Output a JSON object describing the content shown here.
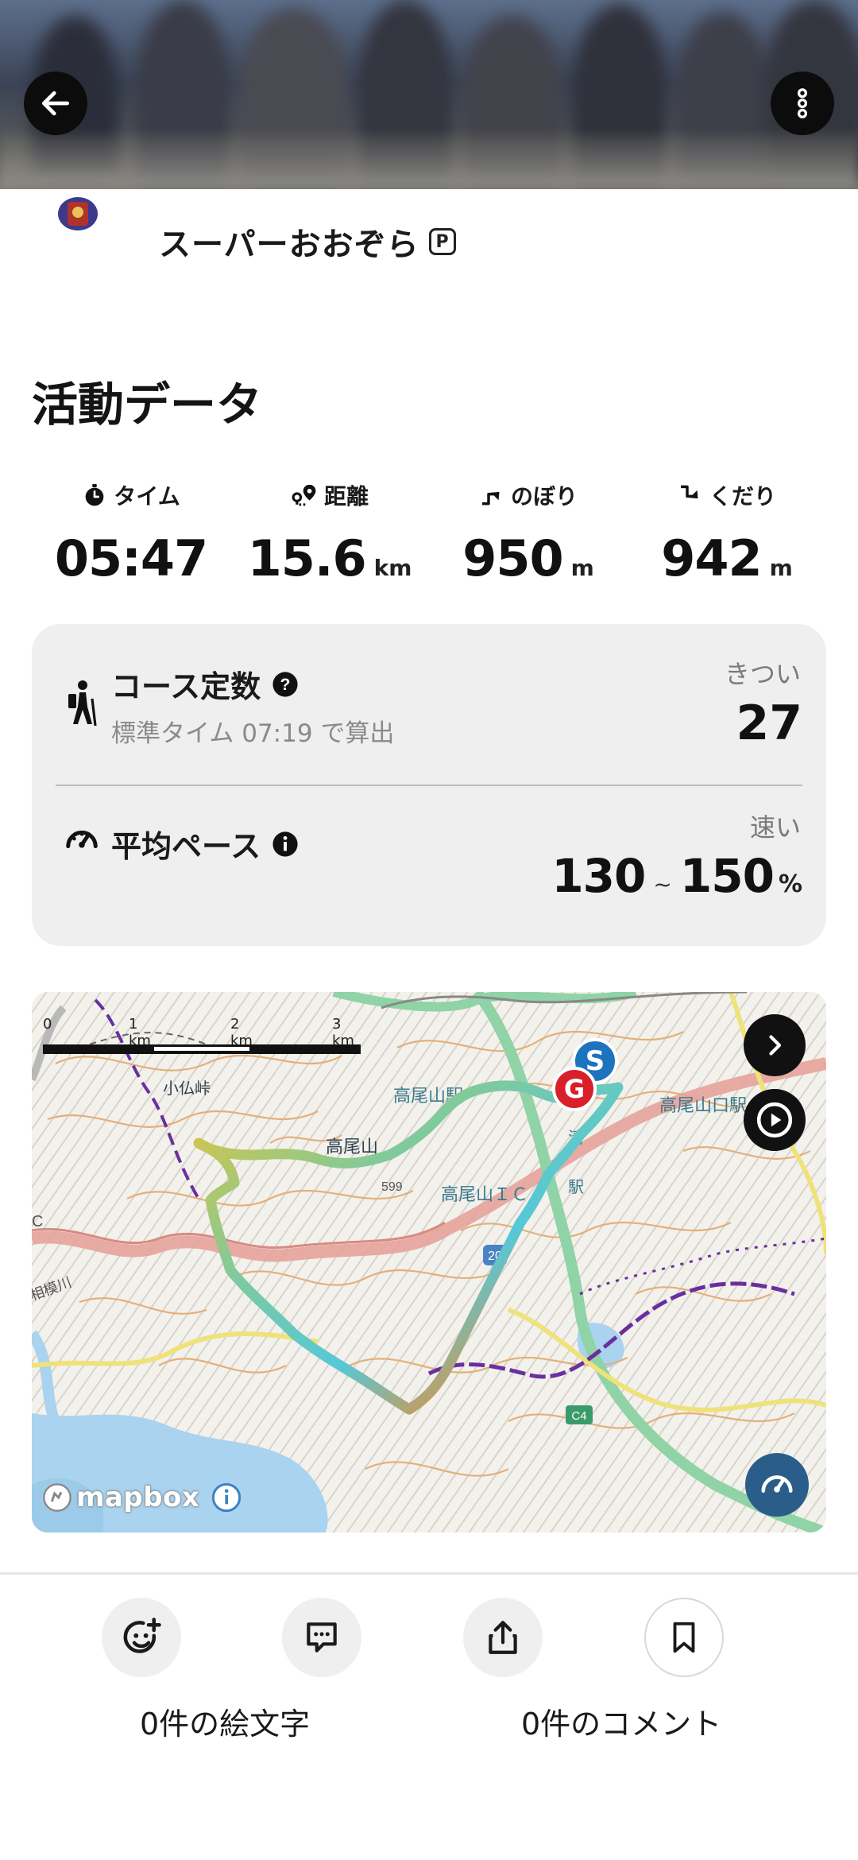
{
  "header": {
    "back_icon": "arrow-left-icon",
    "more_icon": "more-vertical-icon"
  },
  "user": {
    "name": "スーパーおおぞら",
    "badge": "P"
  },
  "section_title": "活動データ",
  "stats": [
    {
      "icon": "stopwatch-icon",
      "label": "タイム",
      "value": "05:47",
      "unit": ""
    },
    {
      "icon": "distance-pin-icon",
      "label": "距離",
      "value": "15.6",
      "unit": "km"
    },
    {
      "icon": "ascent-icon",
      "label": "のぼり",
      "value": "950",
      "unit": "m"
    },
    {
      "icon": "descent-icon",
      "label": "くだり",
      "value": "942",
      "unit": "m"
    }
  ],
  "course_constant": {
    "title": "コース定数",
    "subtitle": "標準タイム 07:19 で算出",
    "level": "きつい",
    "value": "27"
  },
  "average_pace": {
    "title": "平均ペース",
    "level": "速い",
    "min": "130",
    "separator": "~",
    "max": "150",
    "unit": "%"
  },
  "map": {
    "scale_labels": [
      "0",
      "1 km",
      "2 km",
      "3 km"
    ],
    "place_labels": [
      "小仏峠",
      "高尾山駅",
      "高尾山",
      "599",
      "高尾山口駅",
      "清",
      "駅",
      "高尾山ＩＣ",
      "20",
      "C4",
      "C",
      "相模川"
    ],
    "start_marker": "S",
    "goal_marker": "G",
    "attribution": "mapbox"
  },
  "bottom": {
    "emoji_count_label": "0件の絵文字",
    "comment_count_label": "0件のコメント"
  },
  "colors": {
    "accent_route_start": "#e53935",
    "accent_route_end": "#56c8d8",
    "start_marker": "#1e73be",
    "goal_marker": "#d81f2a",
    "pace_button": "#2a5d8a"
  }
}
